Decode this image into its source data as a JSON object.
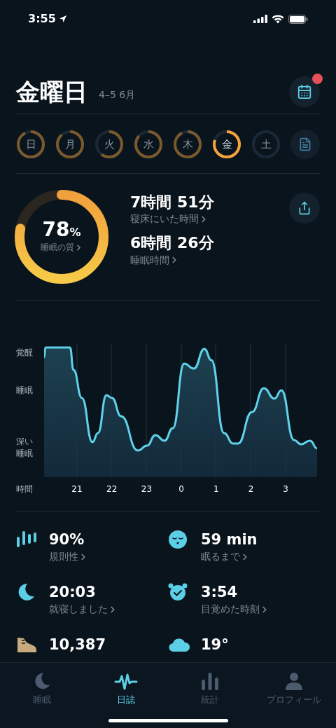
{
  "status_bar": {
    "time": "3:55"
  },
  "header": {
    "title": "金曜日",
    "date_range": "4–5 6月",
    "calendar_badge": true
  },
  "days": [
    {
      "label": "日",
      "selected": false
    },
    {
      "label": "月",
      "selected": false
    },
    {
      "label": "火",
      "selected": false
    },
    {
      "label": "水",
      "selected": false
    },
    {
      "label": "木",
      "selected": false
    },
    {
      "label": "金",
      "selected": true
    },
    {
      "label": "土",
      "selected": false
    }
  ],
  "quality": {
    "value": "78",
    "unit": "%",
    "label": "睡眠の質"
  },
  "durations": [
    {
      "value": "7時間 51分",
      "label": "寝床にいた時間"
    },
    {
      "value": "6時間 26分",
      "label": "睡眠時間"
    }
  ],
  "graph": {
    "y_labels": [
      "覚醒",
      "睡眠",
      "深い",
      "睡眠"
    ],
    "x_title": "時間",
    "x_labels": [
      "21",
      "22",
      "23",
      "0",
      "1",
      "2",
      "3"
    ]
  },
  "stats": [
    {
      "kind": "regularity",
      "value": "90%",
      "label": "規則性"
    },
    {
      "kind": "latency",
      "value": "59 min",
      "label": "眠るまで"
    },
    {
      "kind": "bedtime",
      "value": "20:03",
      "label": "就寝しました"
    },
    {
      "kind": "wakeup",
      "value": "3:54",
      "label": "目覚めた時刻"
    },
    {
      "kind": "steps",
      "value": "10,387"
    },
    {
      "kind": "weather",
      "value": "19°"
    }
  ],
  "tab_bar": [
    {
      "kind": "sleep",
      "label": "睡眠",
      "selected": false
    },
    {
      "kind": "journal",
      "label": "日誌",
      "selected": true
    },
    {
      "kind": "stats",
      "label": "統計",
      "selected": false
    },
    {
      "kind": "profile",
      "label": "プロフィール",
      "selected": false
    }
  ]
}
